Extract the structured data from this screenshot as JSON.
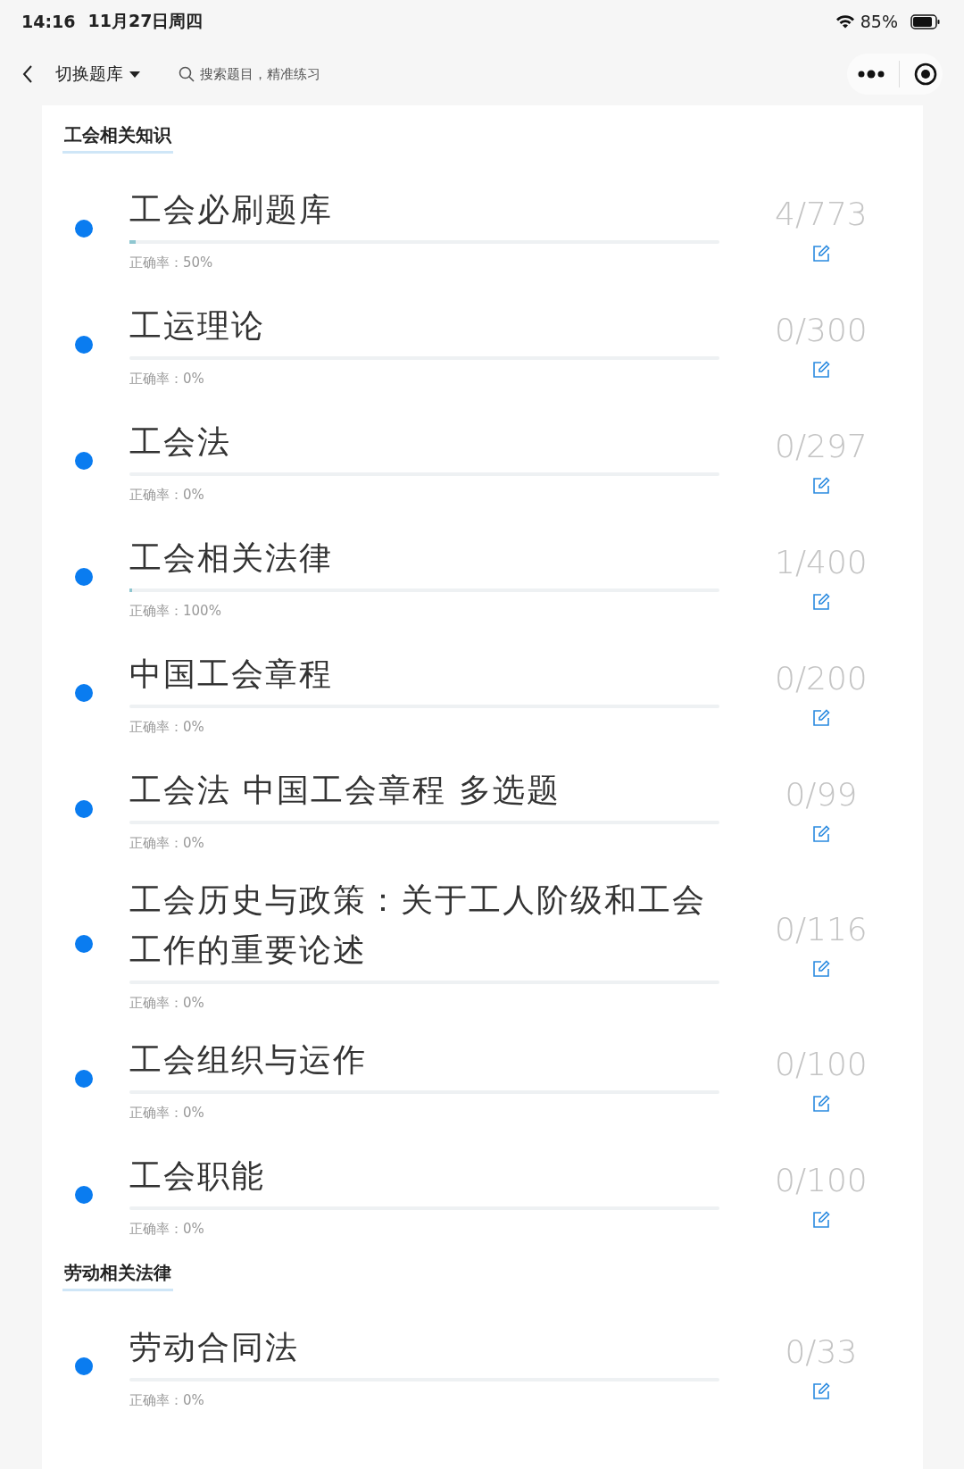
{
  "status_bar": {
    "time": "14:16",
    "date": "11月27日周四",
    "battery": "85%"
  },
  "nav": {
    "switch_label": "切换题库",
    "search": {
      "placeholder": "搜索题目，精准练习"
    }
  },
  "sections": [
    {
      "title": "工会相关知识",
      "items": [
        {
          "title": "工会必刷题库",
          "count": "4/773",
          "accuracy": "正确率：50%",
          "level": 0.01
        },
        {
          "title": "工运理论",
          "count": "0/300",
          "accuracy": "正确率：0%"
        },
        {
          "title": "工会法",
          "count": "0/297",
          "accuracy": "正确率：0%"
        },
        {
          "title": "工会相关法律",
          "count": "1/400",
          "accuracy": "正确率：100%",
          "level": 0.005
        },
        {
          "title": "中国工会章程",
          "count": "0/200",
          "accuracy": "正确率：0%"
        },
        {
          "title": "工会法 中国工会章程 多选题",
          "count": "0/99",
          "accuracy": "正确率：0%"
        },
        {
          "title": "工会历史与政策：关于工人阶级和工会工作的重要论述",
          "count": "0/116",
          "accuracy": "正确率：0%"
        },
        {
          "title": "工会组织与运作",
          "count": "0/100",
          "accuracy": "正确率：0%"
        },
        {
          "title": "工会职能",
          "count": "0/100",
          "accuracy": "正确率：0%"
        }
      ]
    },
    {
      "title": "劳动相关法律",
      "items": [
        {
          "title": "劳动合同法",
          "count": "0/33",
          "accuracy": "正确率：0%"
        }
      ]
    }
  ]
}
